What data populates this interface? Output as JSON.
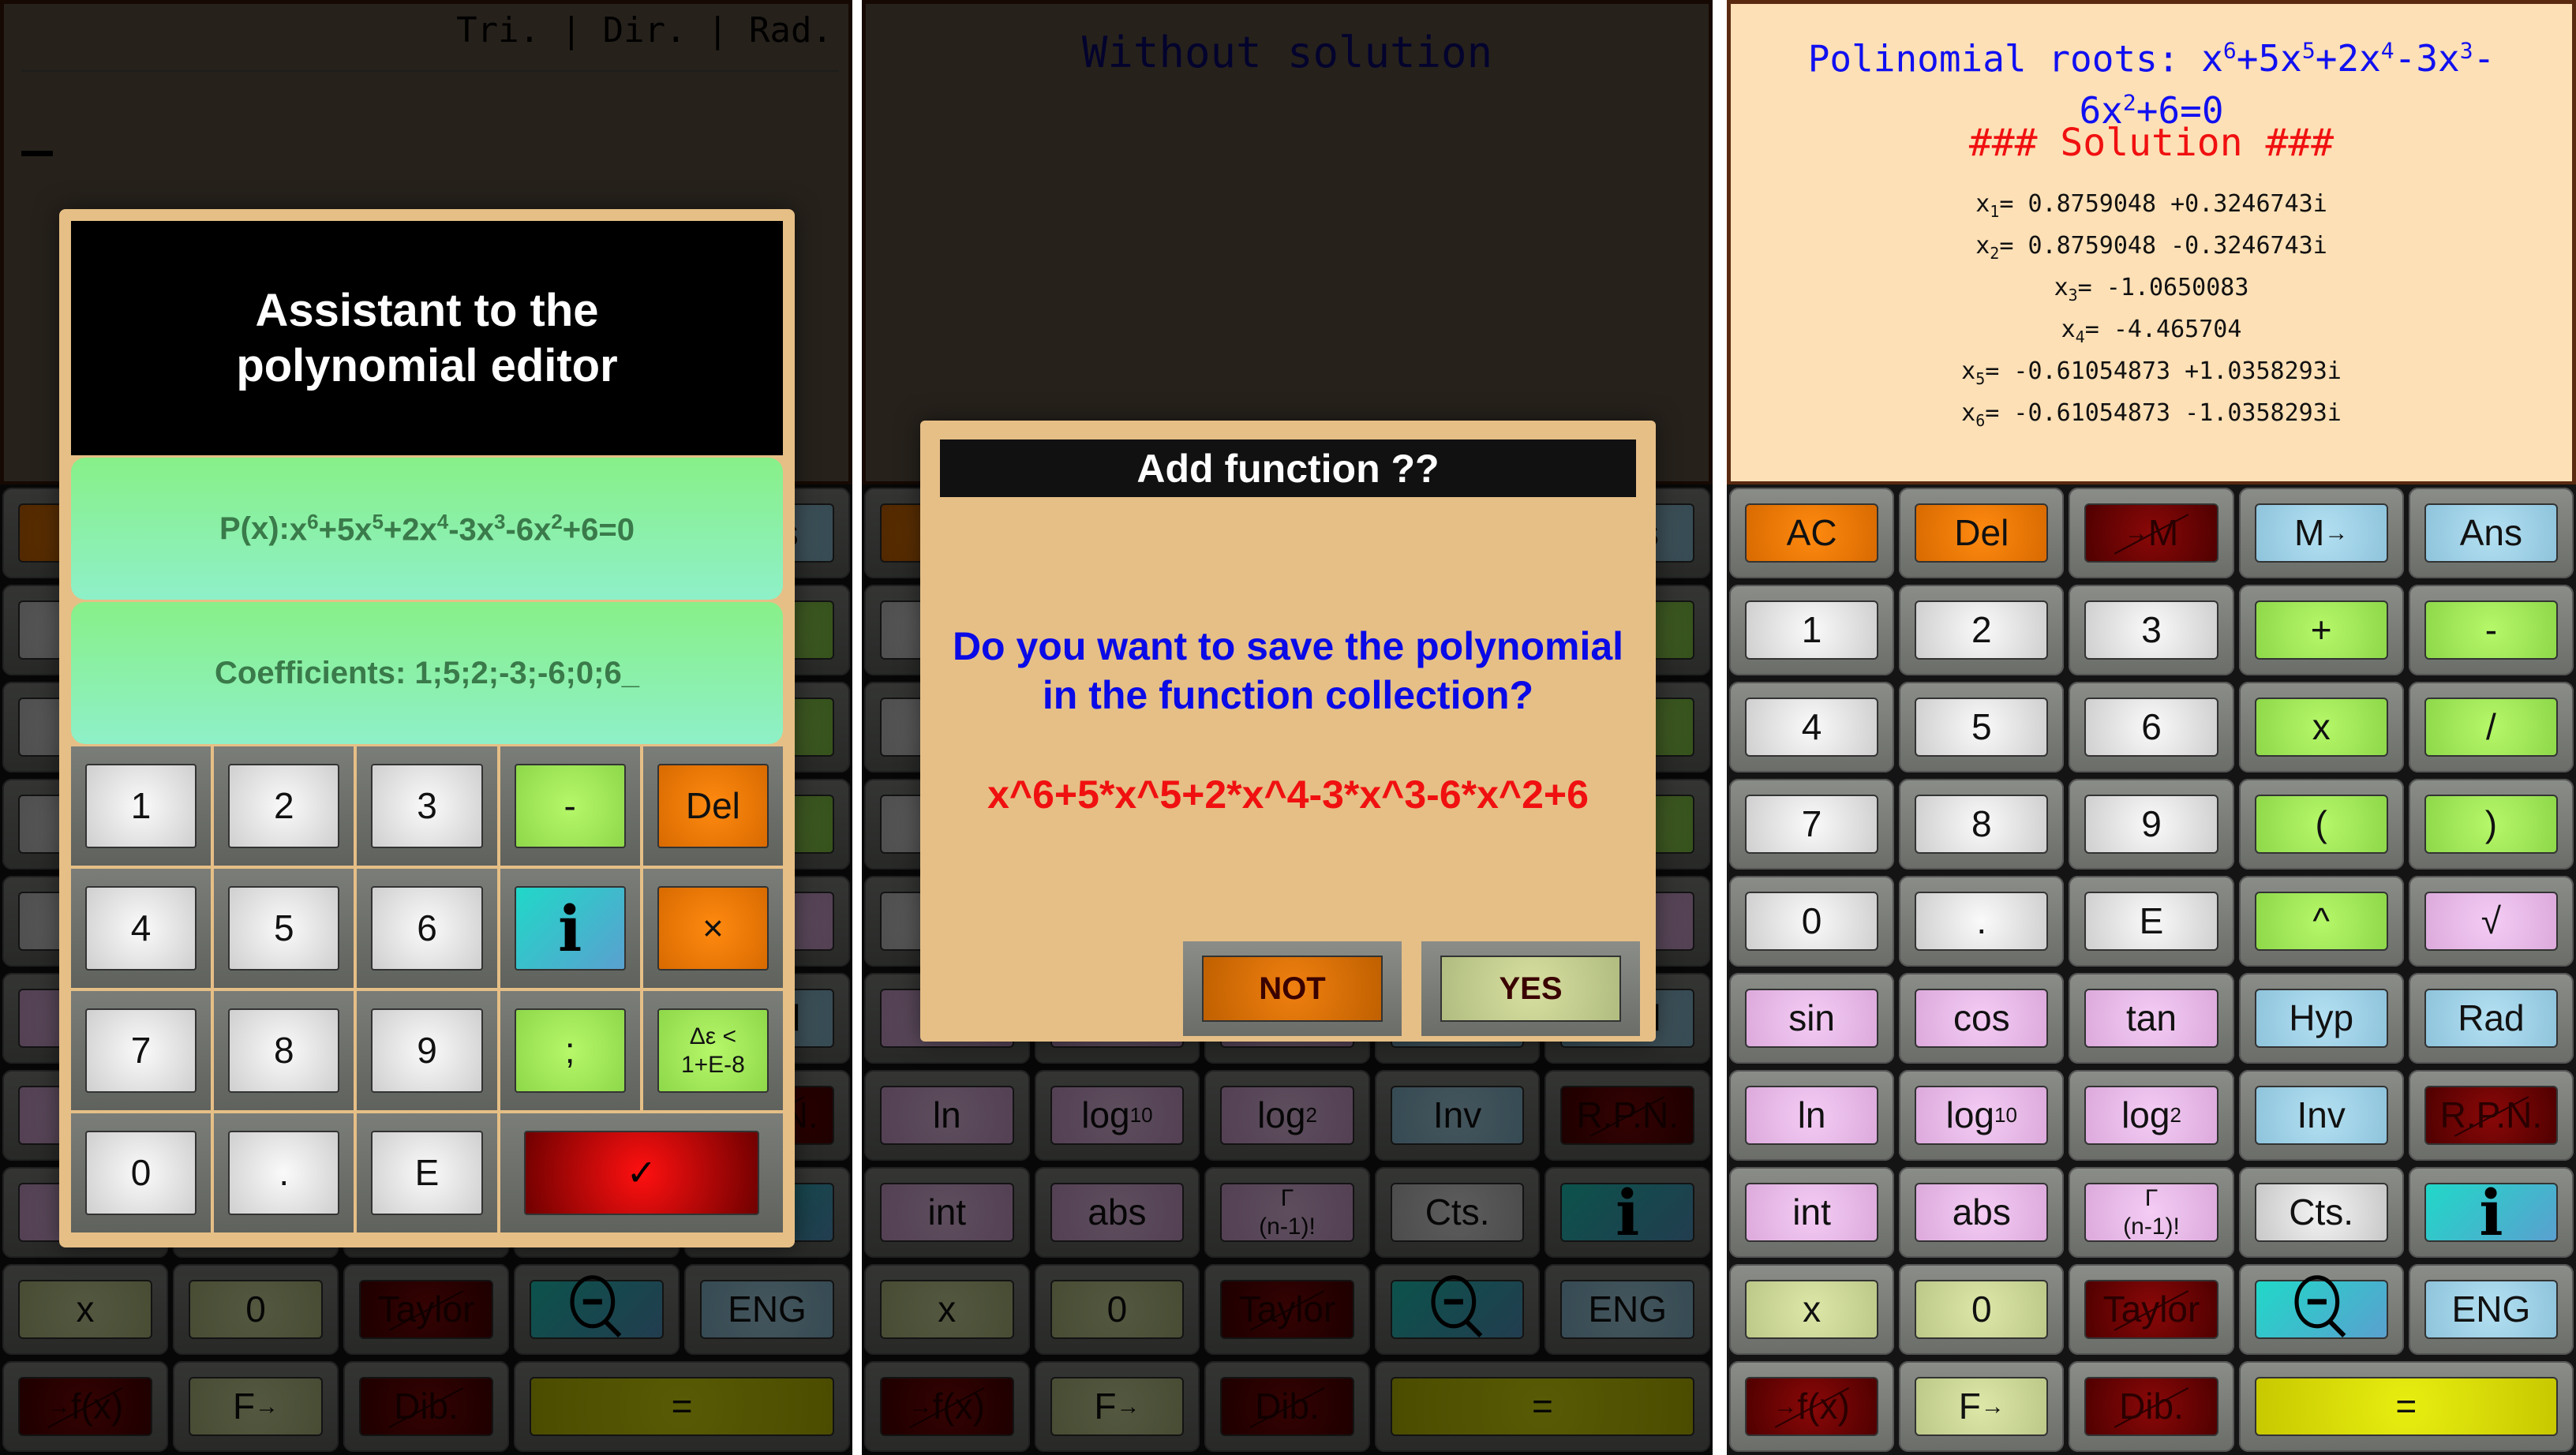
{
  "panel1": {
    "status_line": "Tri. | Dir. | Rad.",
    "dialog": {
      "title": "Assistant to the polynomial editor",
      "polynomial_label": "P(x):",
      "polynomial_terms": [
        "x",
        "6",
        "+5x",
        "5",
        "+2x",
        "4",
        "-3x",
        "3",
        "-6x",
        "2",
        "+6=0"
      ],
      "coefficients": "Coefficients: 1;5;2;-3;-6;0;6_",
      "keys": [
        {
          "label": "1",
          "color": "white"
        },
        {
          "label": "2",
          "color": "white"
        },
        {
          "label": "3",
          "color": "white"
        },
        {
          "label": "-",
          "color": "green"
        },
        {
          "label": "Del",
          "color": "orange"
        },
        {
          "label": "4",
          "color": "white"
        },
        {
          "label": "5",
          "color": "white"
        },
        {
          "label": "6",
          "color": "white"
        },
        {
          "label": "i",
          "color": "teal",
          "icon": "info-icon"
        },
        {
          "label": "×",
          "color": "orange",
          "icon": "close-icon"
        },
        {
          "label": "7",
          "color": "white"
        },
        {
          "label": "8",
          "color": "white"
        },
        {
          "label": "9",
          "color": "white"
        },
        {
          "label": ";",
          "color": "green"
        },
        {
          "label": "Δε < 1+E-8",
          "color": "green"
        },
        {
          "label": "0",
          "color": "white"
        },
        {
          "label": ".",
          "color": "white"
        },
        {
          "label": "E",
          "color": "white"
        },
        {
          "label": "✓",
          "color": "red",
          "icon": "checkmark-icon"
        }
      ]
    }
  },
  "panel2": {
    "display_text": "Without solution",
    "dialog": {
      "title": "Add function ??",
      "question": "Do you want to save the polynomial in the function collection?",
      "function": "x^6+5*x^5+2*x^4-3*x^3-6*x^2+6",
      "not_label": "NOT",
      "yes_label": "YES"
    }
  },
  "panel3": {
    "title_prefix": "Polinomial roots: ",
    "title_terms": [
      "x",
      "6",
      "+5x",
      "5",
      "+2x",
      "4",
      "-3x",
      "3",
      "-6x",
      "2",
      "+6=0"
    ],
    "solution_header": "### Solution ###",
    "roots": [
      {
        "var": "x",
        "index": "1",
        "value": "= 0.8759048 +0.3246743i"
      },
      {
        "var": "x",
        "index": "2",
        "value": "= 0.8759048 -0.3246743i"
      },
      {
        "var": "x",
        "index": "3",
        "value": "= -1.0650083"
      },
      {
        "var": "x",
        "index": "4",
        "value": "= -4.465704"
      },
      {
        "var": "x",
        "index": "5",
        "value": "= -0.61054873 +1.0358293i"
      },
      {
        "var": "x",
        "index": "6",
        "value": "= -0.61054873 -1.0358293i"
      }
    ]
  },
  "keypad": [
    {
      "label": "AC",
      "color": "orange"
    },
    {
      "label": "Del",
      "color": "orange"
    },
    {
      "label": "→M",
      "color": "red",
      "disabled": true
    },
    {
      "label": "M→",
      "color": "blue"
    },
    {
      "label": "Ans",
      "color": "blue"
    },
    {
      "label": "1",
      "color": "white"
    },
    {
      "label": "2",
      "color": "white"
    },
    {
      "label": "3",
      "color": "white"
    },
    {
      "label": "+",
      "color": "green"
    },
    {
      "label": "-",
      "color": "green"
    },
    {
      "label": "4",
      "color": "white"
    },
    {
      "label": "5",
      "color": "white"
    },
    {
      "label": "6",
      "color": "white"
    },
    {
      "label": "x",
      "color": "green"
    },
    {
      "label": "/",
      "color": "green"
    },
    {
      "label": "7",
      "color": "white"
    },
    {
      "label": "8",
      "color": "white"
    },
    {
      "label": "9",
      "color": "white"
    },
    {
      "label": "(",
      "color": "green"
    },
    {
      "label": ")",
      "color": "green"
    },
    {
      "label": "0",
      "color": "white"
    },
    {
      "label": ".",
      "color": "white"
    },
    {
      "label": "E",
      "color": "white"
    },
    {
      "label": "^",
      "color": "green"
    },
    {
      "label": "√",
      "color": "pink"
    },
    {
      "label": "sin",
      "color": "pink"
    },
    {
      "label": "cos",
      "color": "pink"
    },
    {
      "label": "tan",
      "color": "pink"
    },
    {
      "label": "Hyp",
      "color": "blue"
    },
    {
      "label": "Rad",
      "color": "blue"
    },
    {
      "label": "ln",
      "color": "pink"
    },
    {
      "label": "log",
      "sub": "10",
      "color": "pink"
    },
    {
      "label": "log",
      "sub": "2",
      "color": "pink"
    },
    {
      "label": "Inv",
      "color": "blue"
    },
    {
      "label": "R.P.N.",
      "color": "red",
      "disabled": true
    },
    {
      "label": "int",
      "color": "pink"
    },
    {
      "label": "abs",
      "color": "pink"
    },
    {
      "label": "Γ\n(n-1)!",
      "color": "pink"
    },
    {
      "label": "Cts.",
      "color": "gray"
    },
    {
      "label": "i",
      "color": "teal",
      "icon": "info-icon"
    },
    {
      "label": "x",
      "color": "olive"
    },
    {
      "label": "0",
      "color": "olive"
    },
    {
      "label": "Taylor",
      "color": "red",
      "disabled": true
    },
    {
      "label": "",
      "color": "teal",
      "icon": "zoom-out-icon"
    },
    {
      "label": "ENG",
      "color": "blue"
    },
    {
      "label": "→f(x)",
      "color": "red",
      "disabled": true
    },
    {
      "label": "F→",
      "color": "olive"
    },
    {
      "label": "Dib.",
      "color": "red",
      "disabled": true
    },
    {
      "label": "=",
      "color": "yellow",
      "wide": true
    }
  ]
}
